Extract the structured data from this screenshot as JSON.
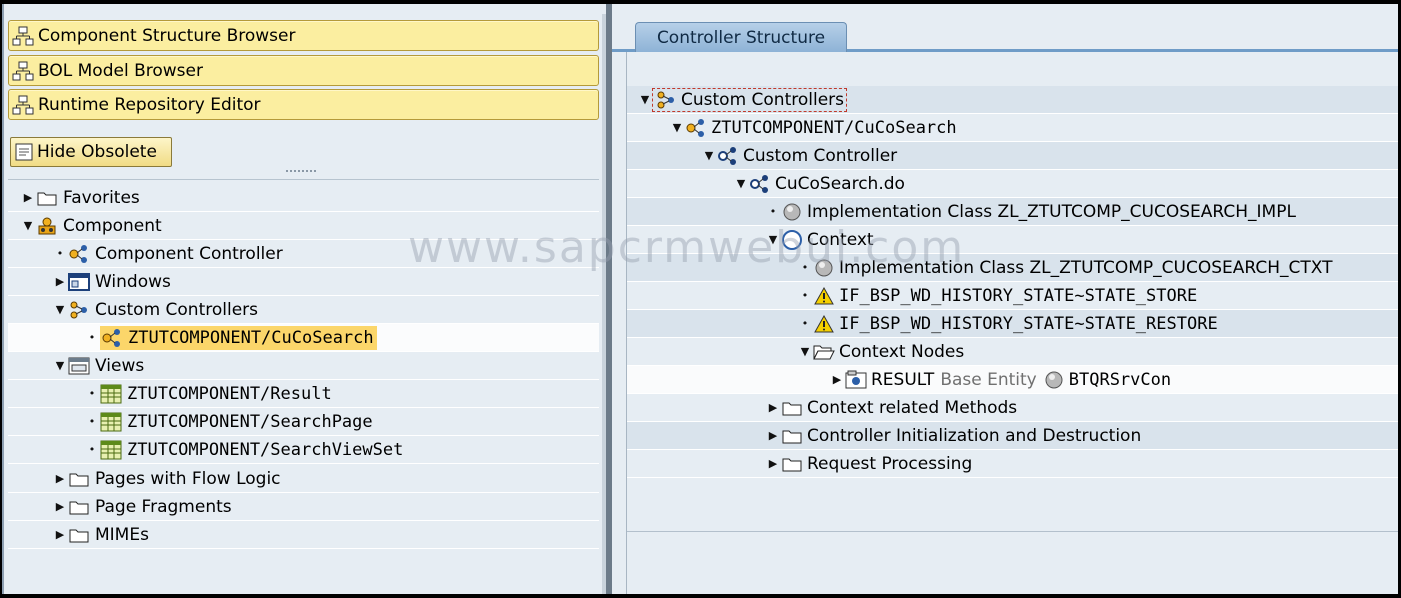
{
  "nav_buttons": [
    {
      "label": "Component Structure Browser",
      "icon": "hierarchy-icon"
    },
    {
      "label": "BOL Model Browser",
      "icon": "hierarchy-icon"
    },
    {
      "label": "Runtime Repository Editor",
      "icon": "hierarchy-icon"
    }
  ],
  "hide_obsolete": {
    "label": "Hide Obsolete",
    "icon": "checkbox-icon"
  },
  "left_tree": {
    "favorites": "Favorites",
    "component": "Component",
    "component_controller": "Component Controller",
    "windows": "Windows",
    "custom_controllers": "Custom Controllers",
    "selected_controller": "ZTUTCOMPONENT/CuCoSearch",
    "views": "Views",
    "view_items": [
      "ZTUTCOMPONENT/Result",
      "ZTUTCOMPONENT/SearchPage",
      "ZTUTCOMPONENT/SearchViewSet"
    ],
    "pages_flow": "Pages with Flow Logic",
    "page_fragments": "Page Fragments",
    "mimes": "MIMEs"
  },
  "right_tab": {
    "label": "Controller Structure"
  },
  "right_tree": {
    "custom_controllers": "Custom Controllers",
    "component_controller": "ZTUTCOMPONENT/CuCoSearch",
    "custom_controller": "Custom Controller",
    "do_file": "CuCoSearch.do",
    "impl_class": "Implementation Class ZL_ZTUTCOMP_CUCOSEARCH_IMPL",
    "context": "Context",
    "ctxt_class": "Implementation Class ZL_ZTUTCOMP_CUCOSEARCH_CTXT",
    "store": "IF_BSP_WD_HISTORY_STATE~STATE_STORE",
    "restore": "IF_BSP_WD_HISTORY_STATE~STATE_RESTORE",
    "context_nodes": "Context Nodes",
    "result_node": "RESULT",
    "base_entity": "Base Entity",
    "entity_name": "BTQRSrvCon",
    "context_methods": "Context related Methods",
    "init_destruction": "Controller Initialization and Destruction",
    "request_processing": "Request Processing"
  },
  "watermark": "www.sapcrmwebui.com",
  "colors": {
    "nav_button_bg": "#fbeea0",
    "selection": "#fbd66a",
    "tab_bg": "#8eb3d6",
    "pane_bg": "#e6edf3"
  }
}
